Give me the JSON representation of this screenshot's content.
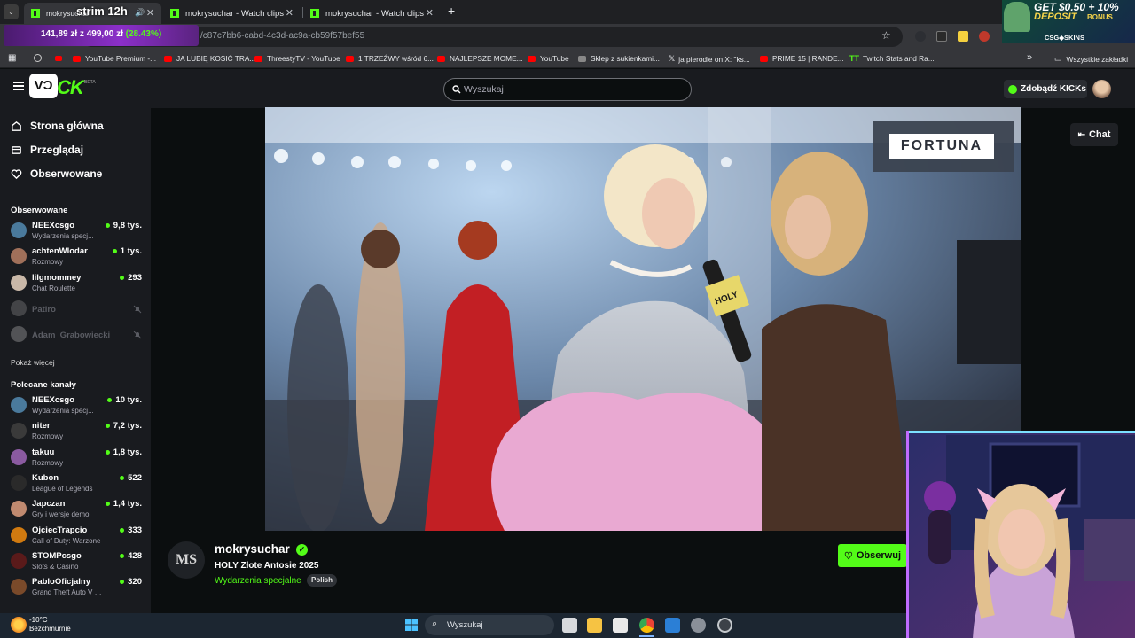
{
  "browser": {
    "tabs": [
      {
        "label": "mokrysuchar",
        "active": true
      },
      {
        "label": "mokrysuchar - Watch clips on K",
        "active": false
      },
      {
        "label": "mokrysuchar - Watch clips on K",
        "active": false
      }
    ],
    "new_tab_symbol": "+",
    "url": "/c87c7bb6-cabd-4c3d-ac9a-cb59f57bef55",
    "bookmarks": [
      "YouTube Premium -...",
      "JA LUBIĘ KOSIĆ TRA...",
      "ThreestyTV - YouTube",
      "1 TRZEŹWY wśród 6...",
      "NAJLEPSZE MOME...",
      "YouTube",
      "Sklep z sukienkami...",
      "ja pierodle on X: \"ks...",
      "PRIME 15 | RANDE...",
      "Twitch Stats and Ra..."
    ],
    "all_bookmarks_label": "Wszystkie zakładki"
  },
  "overlay": {
    "strim_label": "strim 12h",
    "price_text": "141,89 zł z 499,00 zł",
    "price_pct": "(28.43%)",
    "ad_line1": "GET $0.50 + 10%",
    "ad_line2": "DEPOSIT",
    "ad_line3": "BONUS",
    "ad_brand": "CSG◆SKINS"
  },
  "header": {
    "logo_text": "CK",
    "logo_badge": "BETA",
    "search_placeholder": "Wyszukaj",
    "kicks_button": "Zdobądź KICKs"
  },
  "sidebar": {
    "nav": [
      {
        "label": "Strona główna",
        "icon": "home-icon"
      },
      {
        "label": "Przeglądaj",
        "icon": "browse-icon"
      },
      {
        "label": "Obserwowane",
        "icon": "heart-icon"
      }
    ],
    "followed_title": "Obserwowane",
    "followed": [
      {
        "name": "NEEXcsgo",
        "category": "Wydarzenia specj...",
        "viewers": "9,8 tys.",
        "live": true,
        "color": "#4a7a9c"
      },
      {
        "name": "achtenWlodar",
        "category": "Rozmowy",
        "viewers": "1 tys.",
        "live": true,
        "color": "#a0705a"
      },
      {
        "name": "lilgmommey",
        "category": "Chat Roulette",
        "viewers": "293",
        "live": true,
        "color": "#c9b8a8"
      },
      {
        "name": "Patiro",
        "category": "",
        "viewers": "",
        "live": false,
        "color": "#777"
      },
      {
        "name": "Adam_Grabowiecki",
        "category": "",
        "viewers": "",
        "live": false,
        "color": "#999"
      }
    ],
    "show_more": "Pokaż więcej",
    "recommended_title": "Polecane kanały",
    "recommended": [
      {
        "name": "NEEXcsgo",
        "category": "Wydarzenia specj...",
        "viewers": "10 tys.",
        "color": "#4a7a9c"
      },
      {
        "name": "niter",
        "category": "Rozmowy",
        "viewers": "7,2 tys.",
        "color": "#3a3a3a"
      },
      {
        "name": "takuu",
        "category": "Rozmowy",
        "viewers": "1,8 tys.",
        "color": "#8a5aa0"
      },
      {
        "name": "Kubon",
        "category": "League of Legends",
        "viewers": "522",
        "color": "#2a2a2a"
      },
      {
        "name": "Japczan",
        "category": "Gry i wersje demo",
        "viewers": "1,4 tys.",
        "color": "#c08a70"
      },
      {
        "name": "OjciecTrapcio",
        "category": "Call of Duty: Warzone",
        "viewers": "333",
        "color": "#d07a10"
      },
      {
        "name": "STOMPcsgo",
        "category": "Slots & Casino",
        "viewers": "428",
        "color": "#5a1a1a"
      },
      {
        "name": "PabloOficjalny",
        "category": "Grand Theft Auto V (G...",
        "viewers": "320",
        "color": "#7a4a2a"
      }
    ]
  },
  "video": {
    "sponsor": "FORTUNA",
    "mic_label": "HOLY"
  },
  "chat_button": "Chat",
  "stream": {
    "avatar_initials": "MS",
    "channel": "mokrysuchar",
    "title": "HOLY Złote Antosie 2025",
    "category": "Wydarzenia specjalne",
    "tag": "Polish",
    "follow_label": "Obserwuj"
  },
  "taskbar": {
    "temp": "-10°C",
    "weather": "Bezchmurnie",
    "search_placeholder": "Wyszukaj"
  },
  "colors": {
    "kick_green": "#53fc18",
    "bg": "#0b0e0f",
    "panel": "#191b1f"
  }
}
